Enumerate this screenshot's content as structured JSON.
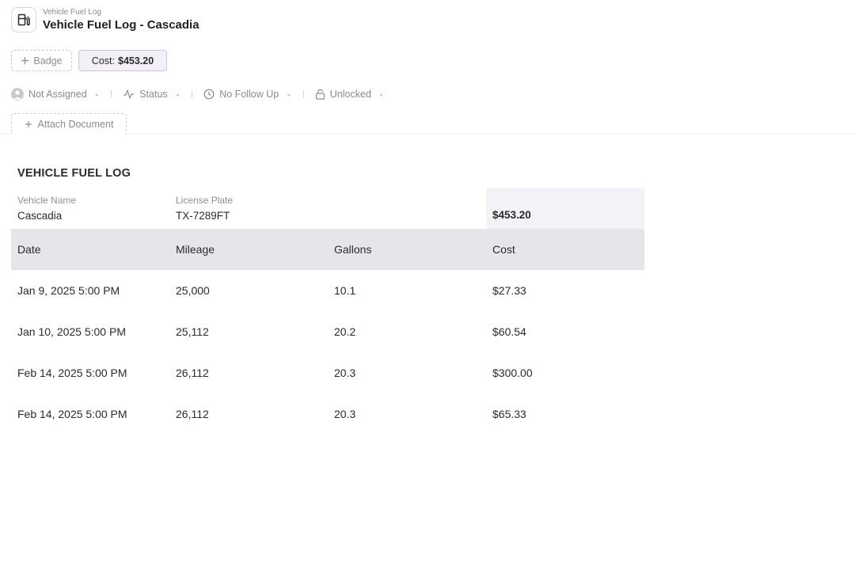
{
  "header": {
    "breadcrumb": "Vehicle Fuel Log",
    "title": "Vehicle Fuel Log - Cascadia",
    "icon": "fuel-pump-icon"
  },
  "badges": {
    "add_label": "Badge",
    "cost_label": "Cost:",
    "cost_value": "$453.20"
  },
  "properties": {
    "assignee": "Not Assigned",
    "status": "Status",
    "follow_up": "No Follow Up",
    "lock": "Unlocked"
  },
  "attach_label": "Attach Document",
  "document": {
    "heading": "VEHICLE FUEL LOG",
    "vehicle_name_label": "Vehicle Name",
    "vehicle_name": "Cascadia",
    "license_plate_label": "License Plate",
    "license_plate": "TX-7289FT",
    "total_cost": "$453.20",
    "columns": [
      "Date",
      "Mileage",
      "Gallons",
      "Cost"
    ],
    "rows": [
      [
        "Jan 9, 2025 5:00 PM",
        "25,000",
        "10.1",
        "$27.33"
      ],
      [
        "Jan 10, 2025 5:00 PM",
        "25,112",
        "20.2",
        "$60.54"
      ],
      [
        "Feb 14, 2025 5:00 PM",
        "26,112",
        "20.3",
        "$300.00"
      ],
      [
        "Feb 14, 2025 5:00 PM",
        "26,112",
        "20.3",
        "$65.33"
      ]
    ]
  },
  "colors": {
    "accent_bg": "#f3f0f7",
    "accent_border": "#cdc3dc",
    "table_header_bg": "#e6e6ea"
  }
}
